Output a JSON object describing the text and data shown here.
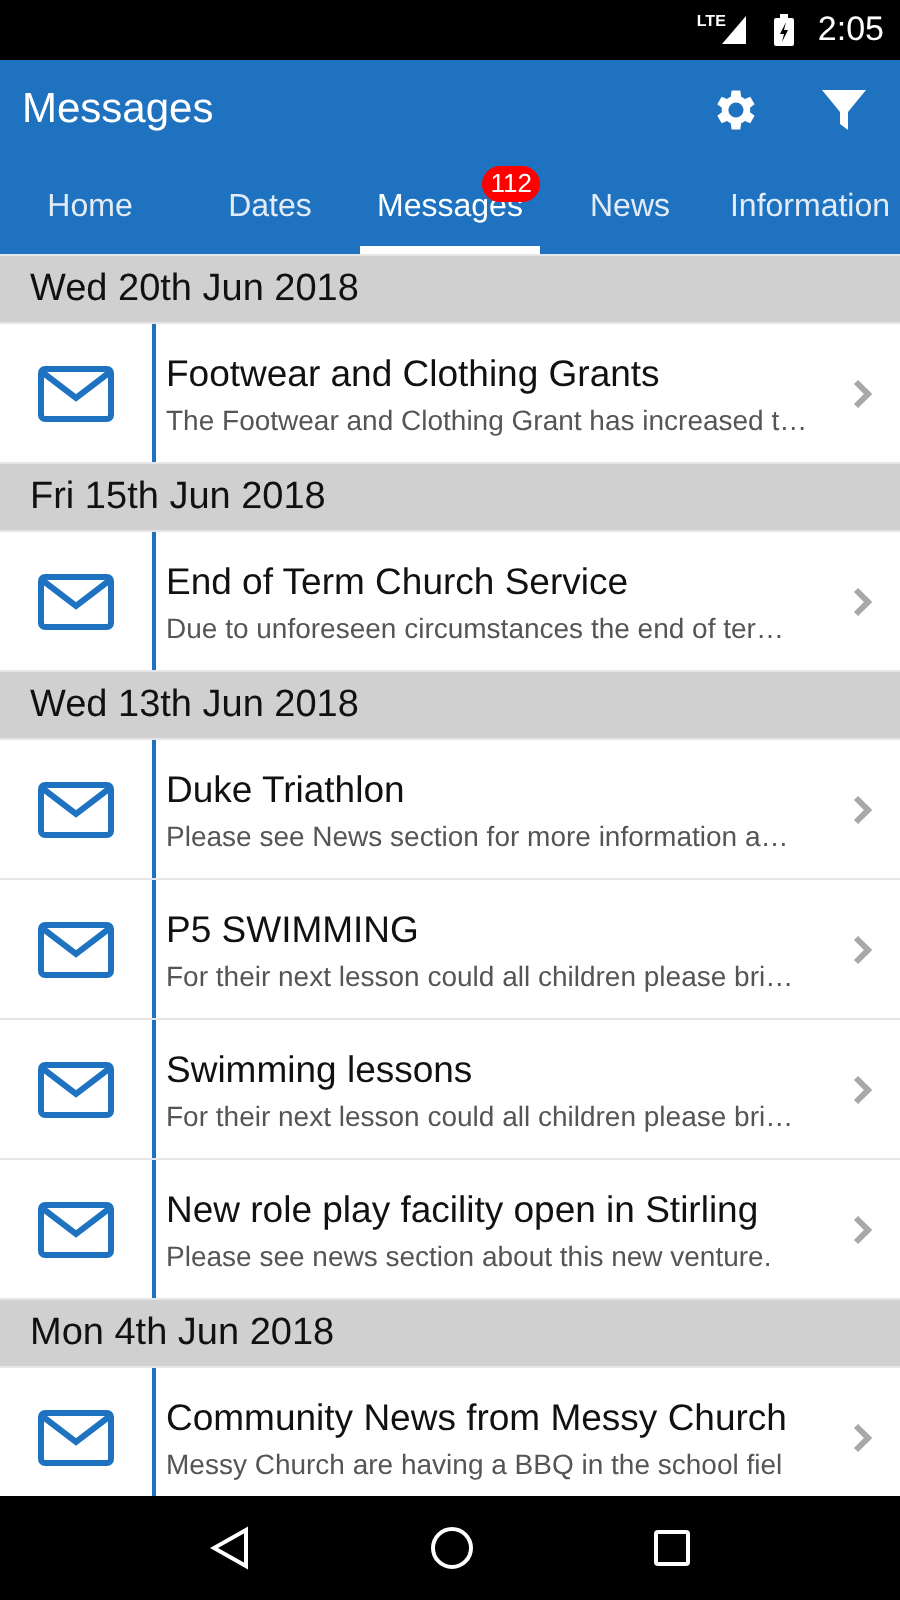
{
  "status_bar": {
    "time": "2:05",
    "network": "LTE"
  },
  "app_bar": {
    "title": "Messages"
  },
  "tabs": [
    {
      "label": "Home",
      "selected": false
    },
    {
      "label": "Dates",
      "selected": false
    },
    {
      "label": "Messages",
      "selected": true,
      "badge": "112"
    },
    {
      "label": "News",
      "selected": false
    },
    {
      "label": "Information",
      "selected": false
    }
  ],
  "sections": [
    {
      "date": "Wed 20th Jun 2018",
      "messages": [
        {
          "title": "Footwear and Clothing Grants",
          "preview": "The Footwear and Clothing Grant has increased t…"
        }
      ]
    },
    {
      "date": "Fri 15th Jun 2018",
      "messages": [
        {
          "title": "End of Term Church Service",
          "preview": "Due to unforeseen circumstances the end of ter…"
        }
      ]
    },
    {
      "date": "Wed 13th Jun 2018",
      "messages": [
        {
          "title": "Duke Triathlon",
          "preview": "Please see News section for more information a…"
        },
        {
          "title": "P5 SWIMMING",
          "preview": "For their next lesson could all children please bri…"
        },
        {
          "title": "Swimming lessons",
          "preview": "For their next lesson could all children please bri…"
        },
        {
          "title": "New role play facility open in Stirling",
          "preview": "Please see news section about this new venture."
        }
      ]
    },
    {
      "date": "Mon 4th Jun 2018",
      "messages": [
        {
          "title": "Community News from Messy Church",
          "preview": "Messy Church are having a BBQ in the school fiel"
        }
      ]
    }
  ]
}
